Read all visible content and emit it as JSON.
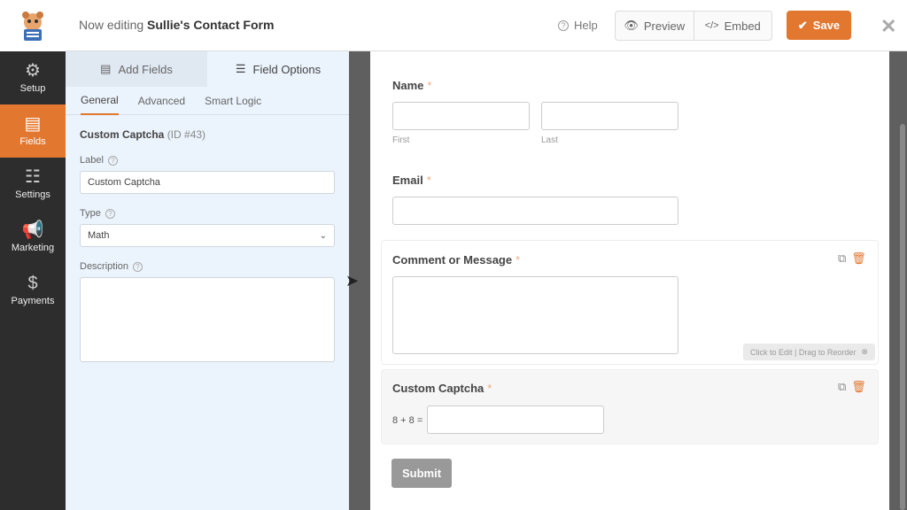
{
  "header": {
    "editing_prefix": "Now editing",
    "form_name": "Sullie's Contact Form",
    "help": "Help",
    "preview": "Preview",
    "embed": "Embed",
    "save": "Save"
  },
  "nav": {
    "items": [
      {
        "label": "Setup",
        "icon": "gear-icon"
      },
      {
        "label": "Fields",
        "icon": "fields-icon"
      },
      {
        "label": "Settings",
        "icon": "sliders-icon"
      },
      {
        "label": "Marketing",
        "icon": "megaphone-icon"
      },
      {
        "label": "Payments",
        "icon": "dollar-icon"
      }
    ],
    "active": "Fields"
  },
  "panel": {
    "tabs": [
      "Add Fields",
      "Field Options"
    ],
    "subtabs": [
      "General",
      "Advanced",
      "Smart Logic"
    ],
    "field_name": "Custom Captcha",
    "field_id": "(ID #43)",
    "label_label": "Label",
    "label_value": "Custom Captcha",
    "type_label": "Type",
    "type_value": "Math",
    "description_label": "Description"
  },
  "form": {
    "name_label": "Name",
    "first": "First",
    "last": "Last",
    "email_label": "Email",
    "comment_label": "Comment or Message",
    "reorder_hint": "Click to Edit | Drag to Reorder",
    "captcha_label": "Custom Captcha",
    "captcha_question": "8 + 8 =",
    "required_mark": "*",
    "submit": "Submit"
  }
}
